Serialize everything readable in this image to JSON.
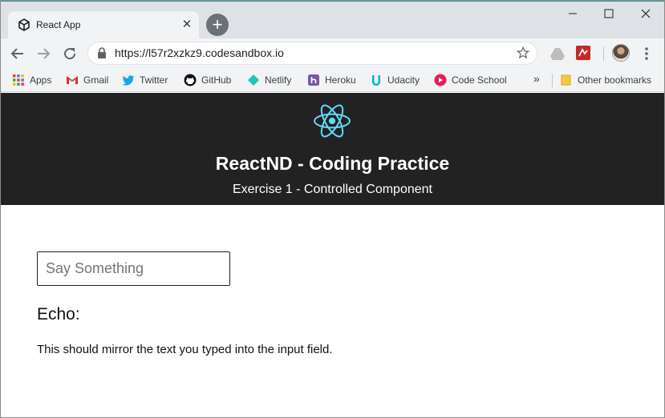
{
  "browser": {
    "tab": {
      "title": "React App"
    },
    "address_bar": {
      "url": "https://l57r2xzkz9.codesandbox.io"
    },
    "bookmarks": [
      {
        "label": "Apps",
        "icon": "apps-grid-icon",
        "color": "#4285f4"
      },
      {
        "label": "Gmail",
        "icon": "gmail-icon",
        "color": "#d93025"
      },
      {
        "label": "Twitter",
        "icon": "twitter-icon",
        "color": "#1da1f2"
      },
      {
        "label": "GitHub",
        "icon": "github-icon",
        "color": "#000000"
      },
      {
        "label": "Netlify",
        "icon": "netlify-icon",
        "color": "#20c6b7"
      },
      {
        "label": "Heroku",
        "icon": "heroku-icon",
        "color": "#79589f"
      },
      {
        "label": "Udacity",
        "icon": "udacity-icon",
        "color": "#02b3e4"
      },
      {
        "label": "Code School",
        "icon": "code-school-icon",
        "color": "#e21e5b"
      }
    ],
    "overflow_label": "»",
    "other_bookmarks": {
      "label": "Other bookmarks",
      "icon": "folder-icon",
      "color": "#f5c842"
    }
  },
  "page": {
    "header": {
      "title": "ReactND - Coding Practice",
      "subtitle": "Exercise 1 - Controlled Component",
      "logo_color": "#61dafb",
      "background": "#222222"
    },
    "input": {
      "placeholder": "Say Something",
      "value": ""
    },
    "echo": {
      "heading": "Echo:",
      "text": "This should mirror the text you typed into the input field."
    }
  }
}
